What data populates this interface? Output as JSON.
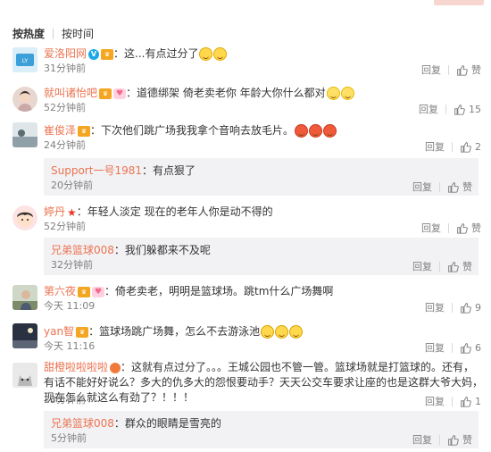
{
  "sort": {
    "hot": "按热度",
    "time": "按时间"
  },
  "comments": [
    {
      "user": "爱洛阳网",
      "text": "：这...有点过分了",
      "time": "31分钟前",
      "reply": "回复",
      "likes": ""
    },
    {
      "user": "就叫诸怡吧",
      "text": "：道德绑架  倚老卖老你  年龄大你什么都对",
      "time": "52分钟前",
      "reply": "回复",
      "likes": "15"
    },
    {
      "user": "崔俊泽",
      "text": "：下次他们跳广场我我拿个音响去放毛片。",
      "time": "24分钟前",
      "reply": "回复",
      "likes": "2"
    },
    {
      "user": "婷丹",
      "text": "：年轻人淡定  现在的老年人你是动不得的",
      "time": "52分钟前",
      "reply": "回复",
      "likes": ""
    },
    {
      "user": "第六夜",
      "text": "：倚老卖老，明明是篮球场。跳tm什么广场舞啊",
      "time": "今天 11:09",
      "reply": "回复",
      "likes": "9"
    },
    {
      "user": "yan智",
      "text": "：篮球场跳广场舞，怎么不去游泳池",
      "time": "今天 11:16",
      "reply": "回复",
      "likes": "6"
    },
    {
      "user": "甜橙啦啦啦啦",
      "text": "：这就有点过分了。。。王城公园也不管一管。篮球场就是打篮球的。还有，有话不能好好说么？多大的仇多大的怨恨要动手？天天公交车要求让座的也是这群大爷大妈，现在怎么就这么有劲了？！！！",
      "time": "23分钟前",
      "reply": "回复",
      "likes": "1"
    }
  ],
  "subreplies": [
    {
      "user": "Support一号1981",
      "text": "：有点狠了",
      "time": "20分钟前",
      "reply": "回复",
      "likes": ""
    },
    {
      "user": "兄弟篮球008",
      "text": "：我们躲都来不及呢",
      "time": "32分钟前",
      "reply": "回复",
      "likes": ""
    },
    {
      "user": "兄弟篮球008",
      "text": "：群众的眼睛是雪亮的",
      "time": "5分钟前",
      "reply": "回复",
      "likes": ""
    }
  ],
  "colors": {
    "accent": "#eb7350",
    "muted": "#808080",
    "subbg": "#f2f2f5"
  },
  "icons": {
    "like": "thumbs-up-icon",
    "verified": "verified-v-icon",
    "vip": "vip-crown-icon",
    "fan": "fan-heart-icon"
  }
}
